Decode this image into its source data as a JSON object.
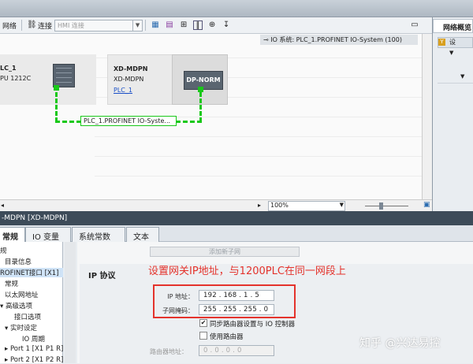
{
  "toolbar": {
    "network_label": "网络",
    "connect_label": "连接",
    "connection_type": "HMI 连接",
    "zoom_in_icon": "magnifier-plus"
  },
  "canvas": {
    "io_system_label": "IO 系统: PLC_1.PROFINET IO-System (100)",
    "plc_name": "LC_1",
    "plc_type": "PU 1212C",
    "device_name": "XD-MDPN",
    "device_type": "XD-MDPN",
    "device_link": "PLC_1",
    "module_label": "DP-NORM",
    "network_label": "PLC_1.PROFINET IO-Syste..."
  },
  "status": {
    "zoom": "100%"
  },
  "right_panel": {
    "tab_label": "网络概览",
    "settings_label": "设"
  },
  "inspector": {
    "title": "-MDPN [XD-MDPN]",
    "tabs": [
      "常规",
      "IO 变量",
      "系统常数",
      "文本"
    ],
    "tree": [
      "规",
      "目录信息",
      "ROFINET接口 [X1]",
      "常规",
      "以太网地址",
      "高级选项",
      "接口选项",
      "实时设定",
      "IO 周期",
      "Port 1 [X1 P1 R]",
      "Port 2 [X1 P2 R]"
    ],
    "add_subnet_button": "添加新子网",
    "section_title": "IP 协议",
    "annotation": "设置网关IP地址，与1200PLC在同一网段上",
    "ip_label": "IP 地址：",
    "ip_value": "192 . 168 . 1   . 5",
    "mask_label": "子网掩码：",
    "mask_value": "255 . 255 . 255 . 0",
    "sync_router_label": "同步路由器设置与 IO 控制器",
    "sync_router_checked": true,
    "use_router_label": "使用路由器",
    "use_router_checked": false,
    "router_label": "路由器地址：",
    "router_value": "0  .  0  .  0  .  0"
  },
  "watermark": "知乎 @兴达易控"
}
